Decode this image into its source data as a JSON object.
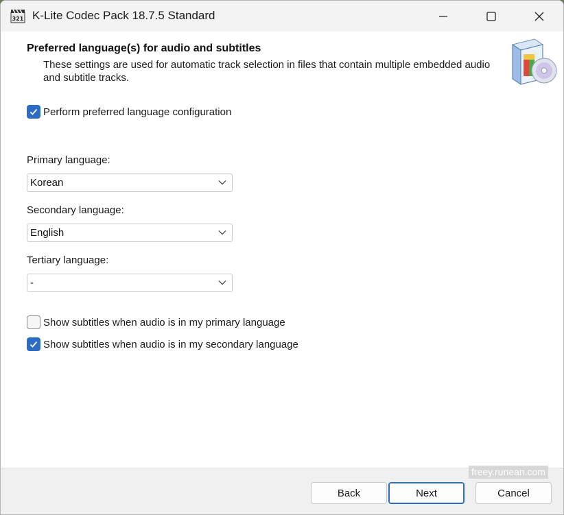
{
  "window": {
    "title": "K-Lite Codec Pack 18.7.5 Standard",
    "app_icon": "clapperboard-321-icon",
    "controls": [
      "minimize-icon",
      "maximize-icon",
      "close-icon"
    ]
  },
  "header": {
    "title": "Preferred language(s) for audio and subtitles",
    "subtitle": "These settings are used for automatic track selection in files that contain multiple embedded audio and subtitle tracks.",
    "image": "software-box-disc-icon"
  },
  "options": {
    "perform_config": {
      "label": "Perform preferred language configuration",
      "checked": true
    },
    "primary": {
      "label": "Primary language:",
      "value": "Korean"
    },
    "secondary": {
      "label": "Secondary language:",
      "value": "English"
    },
    "tertiary": {
      "label": "Tertiary language:",
      "value": "-"
    },
    "subs_primary": {
      "label": "Show subtitles when audio is in my primary language",
      "checked": false
    },
    "subs_secondary": {
      "label": "Show subtitles when audio is in my secondary language",
      "checked": true
    }
  },
  "footer": {
    "back_label": "Back",
    "next_label": "Next",
    "cancel_label": "Cancel"
  },
  "watermark": "freey.runean.com",
  "colors": {
    "accent": "#2c6cc4",
    "titlebar": "#f3f3f3",
    "footer": "#f0f0f0"
  }
}
